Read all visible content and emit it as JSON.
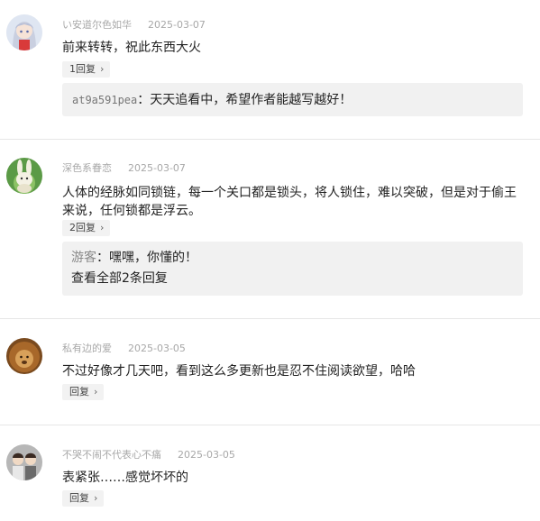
{
  "comments": [
    {
      "username": "い安道尔色如华",
      "date": "2025-03-07",
      "avatar": "anime-girl-avatar",
      "text": "前来转转，祝此东西大火",
      "reply_btn": "1回复",
      "replies": [
        {
          "user": "at9a591pea",
          "sep": "：",
          "text": "天天追看中，希望作者能越写越好！"
        }
      ]
    },
    {
      "username": "深色系眷恋",
      "date": "2025-03-07",
      "avatar": "rabbit-avatar",
      "text": "人体的经脉如同锁链，每一个关口都是锁头，将人锁住，难以突破，但是对于偷王来说，任何锁都是浮云。",
      "reply_btn": "2回复",
      "replies": [
        {
          "user": "游客",
          "sep": "：",
          "text": "嘿嘿，你懂的！"
        }
      ],
      "view_all": "查看全部2条回复"
    },
    {
      "username": "私有边的爱",
      "date": "2025-03-05",
      "avatar": "lion-avatar",
      "text": "不过好像才几天吧，看到这么多更新也是忍不住阅读欲望，哈哈",
      "reply_btn": "回复"
    },
    {
      "username": "不哭不闹不代表心不痛",
      "date": "2025-03-05",
      "avatar": "couple-avatar",
      "text": "表紧张……感觉坏坏的",
      "reply_btn": "回复"
    }
  ],
  "chevron": "›"
}
